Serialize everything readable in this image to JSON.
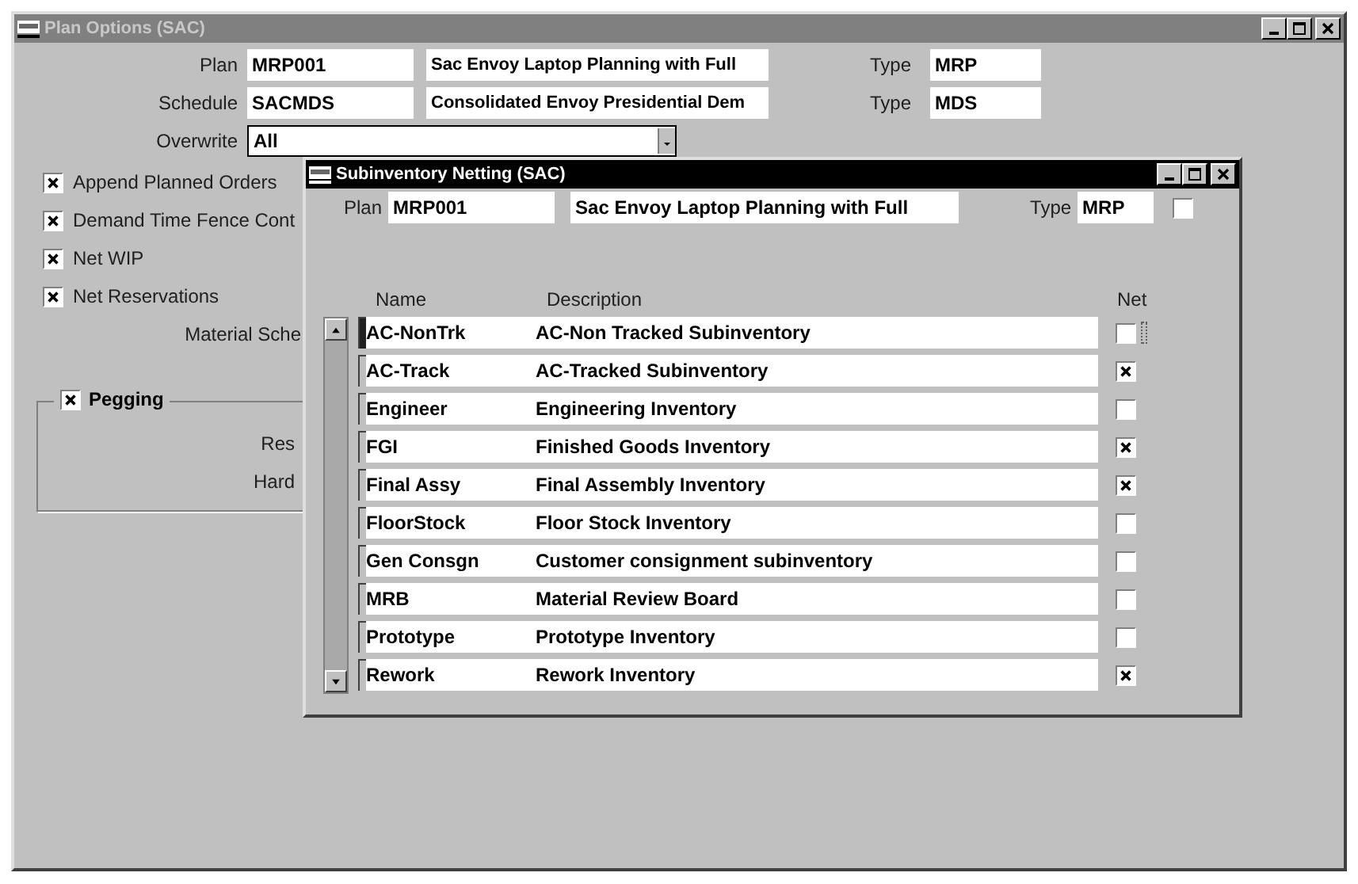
{
  "main_window": {
    "title": "Plan Options (SAC)",
    "plan": {
      "label": "Plan",
      "value": "MRP001",
      "description": "Sac Envoy Laptop Planning with Full",
      "type_label": "Type",
      "type_value": "MRP"
    },
    "schedule": {
      "label": "Schedule",
      "value": "SACMDS",
      "description": "Consolidated Envoy Presidential Dem",
      "type_label": "Type",
      "type_value": "MDS"
    },
    "overwrite": {
      "label": "Overwrite",
      "value": "All"
    },
    "options": [
      {
        "label": "Append Planned Orders",
        "checked": true
      },
      {
        "label": "Demand Time Fence Cont",
        "checked": true
      },
      {
        "label": "Net WIP",
        "checked": true
      },
      {
        "label": "Net Reservations",
        "checked": true
      }
    ],
    "material_label": "Material Sche",
    "pegging": {
      "label": "Pegging",
      "checked": true,
      "fields": [
        "Res",
        "Hard"
      ]
    }
  },
  "dialog": {
    "title": "Subinventory Netting (SAC)",
    "plan_label": "Plan",
    "plan_value": "MRP001",
    "description": "Sac Envoy Laptop Planning with Full",
    "type_label": "Type",
    "type_value": "MRP",
    "type_checked": false,
    "columns": [
      "Name",
      "Description",
      "Net"
    ],
    "rows": [
      {
        "name": "AC-NonTrk",
        "description": "AC-Non Tracked Subinventory",
        "net": false,
        "selected": true
      },
      {
        "name": "AC-Track",
        "description": "AC-Tracked Subinventory",
        "net": true,
        "selected": false
      },
      {
        "name": "Engineer",
        "description": "Engineering Inventory",
        "net": false,
        "selected": false
      },
      {
        "name": "FGI",
        "description": "Finished Goods Inventory",
        "net": true,
        "selected": false
      },
      {
        "name": "Final Assy",
        "description": "Final Assembly Inventory",
        "net": true,
        "selected": false
      },
      {
        "name": "FloorStock",
        "description": "Floor Stock Inventory",
        "net": false,
        "selected": false
      },
      {
        "name": "Gen Consgn",
        "description": "Customer consignment subinventory",
        "net": false,
        "selected": false
      },
      {
        "name": "MRB",
        "description": "Material Review Board",
        "net": false,
        "selected": false
      },
      {
        "name": "Prototype",
        "description": "Prototype Inventory",
        "net": false,
        "selected": false
      },
      {
        "name": "Rework",
        "description": "Rework Inventory",
        "net": true,
        "selected": false
      }
    ]
  }
}
